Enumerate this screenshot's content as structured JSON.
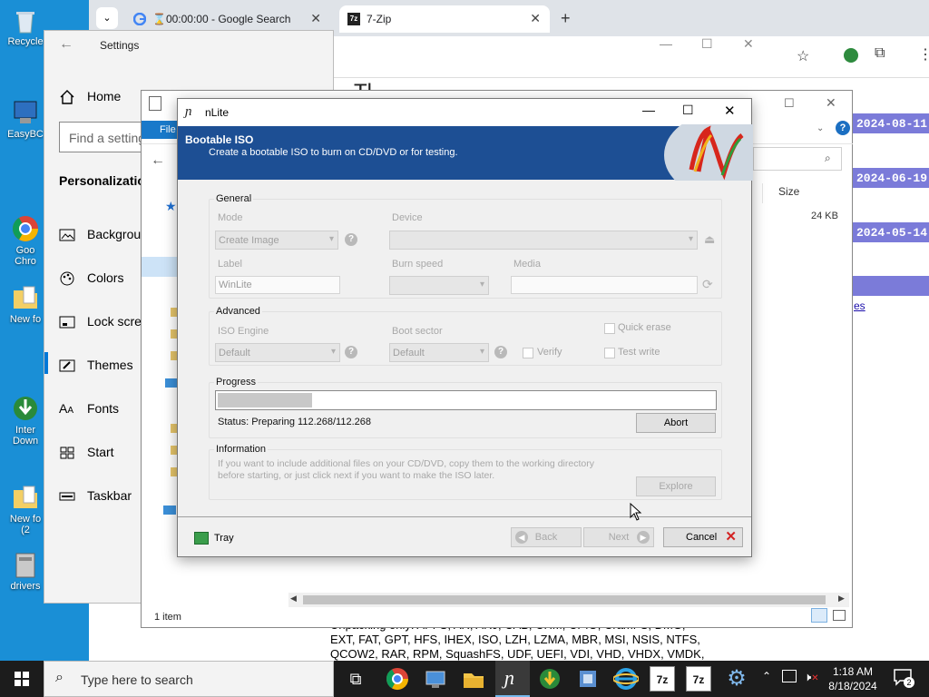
{
  "desktop": {
    "icons": [
      {
        "label": "Recycle"
      },
      {
        "label": "EasyBC"
      },
      {
        "label": "Goo\nChro"
      },
      {
        "label": "New fo"
      },
      {
        "label": "Inter\nDown"
      },
      {
        "label": "New fo\n(2"
      },
      {
        "label": "drivers"
      }
    ]
  },
  "browser": {
    "tabs": [
      {
        "label": "⌛00:00:00 - Google Search",
        "icon": "google-icon"
      },
      {
        "label": "7-Zip",
        "icon": "7zip-icon"
      }
    ],
    "new_tab": "+",
    "page": {
      "heading": "Tl",
      "dates": [
        "2024-08-11",
        "2024-06-19",
        "2024-05-14"
      ],
      "link": "es",
      "text_lines": [
        "Unpacking only: APFS, AR, ARJ, CAB, CHM, CPIO, CramFS, DMG,",
        "EXT, FAT, GPT, HFS, IHEX, ISO, LZH, LZMA, MBR, MSI, NSIS, NTFS,",
        "QCOW2, RAR, RPM, SquashFS, UDF, UEFI, VDI, VHD, VHDX, VMDK,"
      ]
    }
  },
  "settings": {
    "title": "Settings",
    "home": "Home",
    "search_placeholder": "Find a setting",
    "section": "Personalization",
    "nav": [
      {
        "label": "Background",
        "icon": "picture-icon"
      },
      {
        "label": "Colors",
        "icon": "palette-icon"
      },
      {
        "label": "Lock screen",
        "icon": "lock-screen-icon"
      },
      {
        "label": "Themes",
        "icon": "brush-icon"
      },
      {
        "label": "Fonts",
        "icon": "fonts-icon"
      },
      {
        "label": "Start",
        "icon": "start-icon"
      },
      {
        "label": "Taskbar",
        "icon": "taskbar-icon"
      }
    ]
  },
  "explorer": {
    "menu_file": "File",
    "col_size": "Size",
    "size_value": "24 KB",
    "status": "1 item"
  },
  "nlite": {
    "title": "nLite",
    "banner_title": "Bootable ISO",
    "banner_sub": "Create a bootable ISO to burn on CD/DVD or for testing.",
    "general": {
      "title": "General",
      "mode_label": "Mode",
      "mode_value": "Create Image",
      "device_label": "Device",
      "device_value": "",
      "label_label": "Label",
      "label_value": "WinLite",
      "burn_label": "Burn speed",
      "media_label": "Media"
    },
    "advanced": {
      "title": "Advanced",
      "engine_label": "ISO Engine",
      "engine_value": "Default",
      "boot_label": "Boot sector",
      "boot_value": "Default",
      "verify": "Verify",
      "quick_erase": "Quick erase",
      "test_write": "Test write"
    },
    "progress": {
      "title": "Progress",
      "fraction": 0.19,
      "status": "Status: Preparing 112.268/112.268",
      "abort": "Abort"
    },
    "information": {
      "title": "Information",
      "text": "If you want to include additional files on your CD/DVD, copy them to the working directory before starting, or just click next if you want to make the ISO later.",
      "explore": "Explore"
    },
    "footer": {
      "tray": "Tray",
      "back": "Back",
      "next": "Next",
      "cancel": "Cancel"
    }
  },
  "taskbar": {
    "search_placeholder": "Type here to search",
    "time": "1:18 AM",
    "date": "8/18/2024",
    "notification_count": "2"
  },
  "colors": {
    "desktop": "#1a8fd6",
    "banner": "#1d4f94",
    "date_cell": "#7b7bd9",
    "accent": "#0078d7"
  }
}
